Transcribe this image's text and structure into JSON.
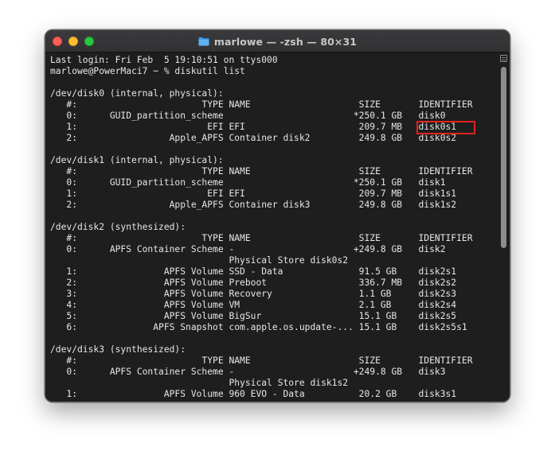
{
  "window": {
    "title": "marlowe — -zsh — 80×31"
  },
  "terminal": {
    "lines": [
      "Last login: Fri Feb  5 19:10:51 on ttys000",
      "marlowe@PowerMaci7 ~ % diskutil list",
      "",
      "/dev/disk0 (internal, physical):",
      "   #:                       TYPE NAME                    SIZE       IDENTIFIER",
      "   0:      GUID_partition_scheme                        *250.1 GB   disk0",
      "   1:                        EFI EFI                     209.7 MB   disk0s1",
      "   2:                 Apple_APFS Container disk2         249.8 GB   disk0s2",
      "",
      "/dev/disk1 (internal, physical):",
      "   #:                       TYPE NAME                    SIZE       IDENTIFIER",
      "   0:      GUID_partition_scheme                        *250.1 GB   disk1",
      "   1:                        EFI EFI                     209.7 MB   disk1s1",
      "   2:                 Apple_APFS Container disk3         249.8 GB   disk1s2",
      "",
      "/dev/disk2 (synthesized):",
      "   #:                       TYPE NAME                    SIZE       IDENTIFIER",
      "   0:      APFS Container Scheme -                      +249.8 GB   disk2",
      "                                 Physical Store disk0s2",
      "   1:                APFS Volume SSD - Data              91.5 GB    disk2s1",
      "   2:                APFS Volume Preboot                 336.7 MB   disk2s2",
      "   3:                APFS Volume Recovery                1.1 GB     disk2s3",
      "   4:                APFS Volume VM                      2.1 GB     disk2s4",
      "   5:                APFS Volume BigSur                  15.1 GB    disk2s5",
      "   6:              APFS Snapshot com.apple.os.update-... 15.1 GB    disk2s5s1",
      "",
      "/dev/disk3 (synthesized):",
      "   #:                       TYPE NAME                    SIZE       IDENTIFIER",
      "   0:      APFS Container Scheme -                      +249.8 GB   disk3",
      "                                 Physical Store disk1s2",
      "   1:                APFS Volume 960 EVO - Data          20.2 GB    disk3s1"
    ]
  },
  "highlight": {
    "color": "#e0231f"
  }
}
